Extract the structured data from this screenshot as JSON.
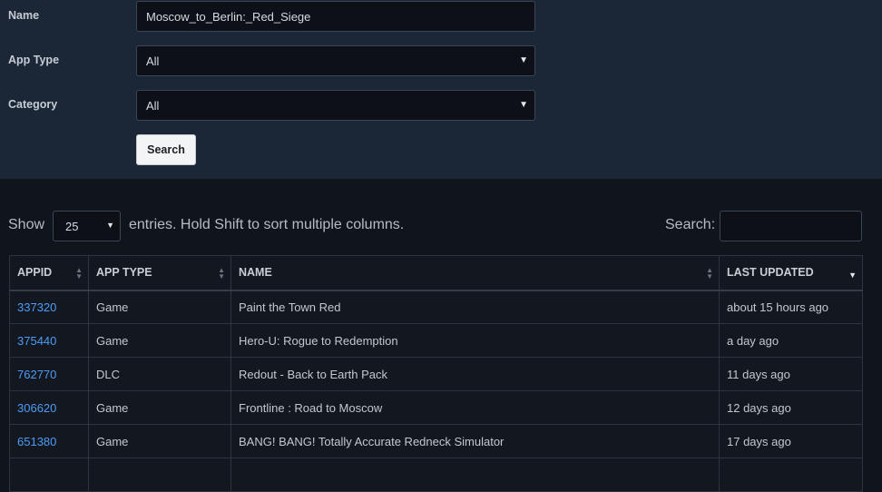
{
  "form": {
    "name_label": "Name",
    "name_value": "Moscow_to_Berlin:_Red_Siege",
    "apptype_label": "App Type",
    "apptype_value": "All",
    "category_label": "Category",
    "category_value": "All",
    "search_button": "Search"
  },
  "controls": {
    "show_label": "Show",
    "page_length": "25",
    "entries_text": "entries. Hold Shift to sort multiple columns.",
    "search_label": "Search:",
    "search_value": ""
  },
  "table": {
    "headers": [
      "APPID",
      "APP TYPE",
      "NAME",
      "LAST UPDATED"
    ],
    "rows": [
      {
        "appid": "337320",
        "type": "Game",
        "name": "Paint the Town Red",
        "updated": "about 15 hours ago"
      },
      {
        "appid": "375440",
        "type": "Game",
        "name": "Hero-U: Rogue to Redemption",
        "updated": "a day ago"
      },
      {
        "appid": "762770",
        "type": "DLC",
        "name": "Redout - Back to Earth Pack",
        "updated": "11 days ago"
      },
      {
        "appid": "306620",
        "type": "Game",
        "name": "Frontline : Road to Moscow",
        "updated": "12 days ago"
      },
      {
        "appid": "651380",
        "type": "Game",
        "name": "BANG! BANG! Totally Accurate Redneck Simulator",
        "updated": "17 days ago"
      },
      {
        "appid": "",
        "type": "",
        "name": "",
        "updated": ""
      }
    ]
  },
  "colors": {
    "panel_bg": "#1b2637",
    "page_bg": "#10141b",
    "link": "#4e9bf5"
  }
}
